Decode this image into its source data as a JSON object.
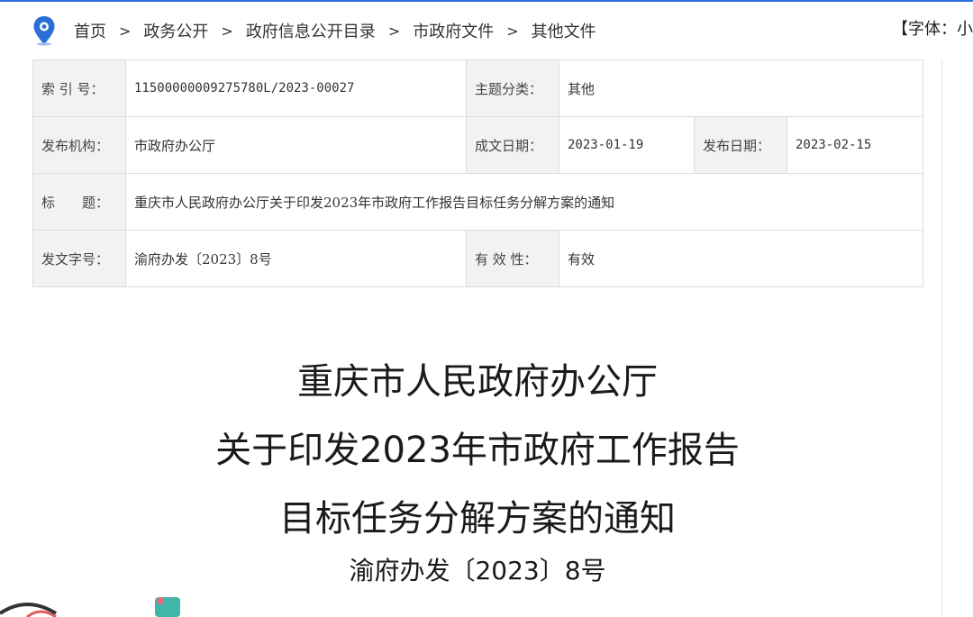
{
  "breadcrumb": {
    "items": [
      "首页",
      "政务公开",
      "政府信息公开目录",
      "市政府文件",
      "其他文件"
    ],
    "separator": ">"
  },
  "font_control": {
    "label": "【字体：小"
  },
  "meta": {
    "index_label": "索 引 号：",
    "index_value": "11500000009275780L/2023-00027",
    "category_label": "主题分类：",
    "category_value": "其他",
    "publisher_label": "发布机构：",
    "publisher_value": "市政府办公厅",
    "created_label": "成文日期：",
    "created_value": "2023-01-19",
    "published_label": "发布日期：",
    "published_value": "2023-02-15",
    "title_label": "标　　题：",
    "title_value": "重庆市人民政府办公厅关于印发2023年市政府工作报告目标任务分解方案的通知",
    "docno_label": "发文字号：",
    "docno_value": "渝府办发〔2023〕8号",
    "validity_label": "有 效 性：",
    "validity_value": "有效"
  },
  "document": {
    "title_lines": [
      "重庆市人民政府办公厅",
      "关于印发2023年市政府工作报告",
      "目标任务分解方案的通知"
    ],
    "doc_number": "渝府办发〔2023〕8号"
  },
  "colors": {
    "accent": "#2b6fd6",
    "label_bg": "#f2f2f2",
    "border": "#dddddd"
  },
  "icons": {
    "location": "location-pin-icon"
  }
}
